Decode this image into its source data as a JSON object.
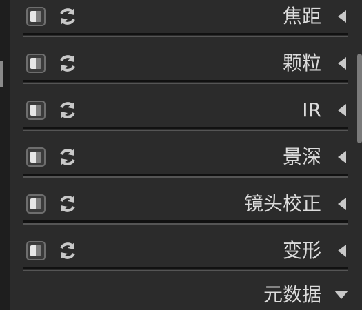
{
  "modules": [
    {
      "title": "焦距",
      "state": "collapsed"
    },
    {
      "title": "颗粒",
      "state": "collapsed"
    },
    {
      "title": "IR",
      "state": "collapsed"
    },
    {
      "title": "景深",
      "state": "collapsed"
    },
    {
      "title": "镜头校正",
      "state": "collapsed"
    },
    {
      "title": "变形",
      "state": "collapsed"
    }
  ],
  "section": {
    "title": "元数据",
    "state": "expanded"
  },
  "icons": {
    "toggle": "module-toggle-icon",
    "reset": "reset-icon",
    "collapsed": "triangle-left-icon",
    "expanded": "triangle-down-icon"
  },
  "colors": {
    "background": "#2b2b2b",
    "text": "#dcdcdc",
    "icon": "#c8c8c8"
  }
}
